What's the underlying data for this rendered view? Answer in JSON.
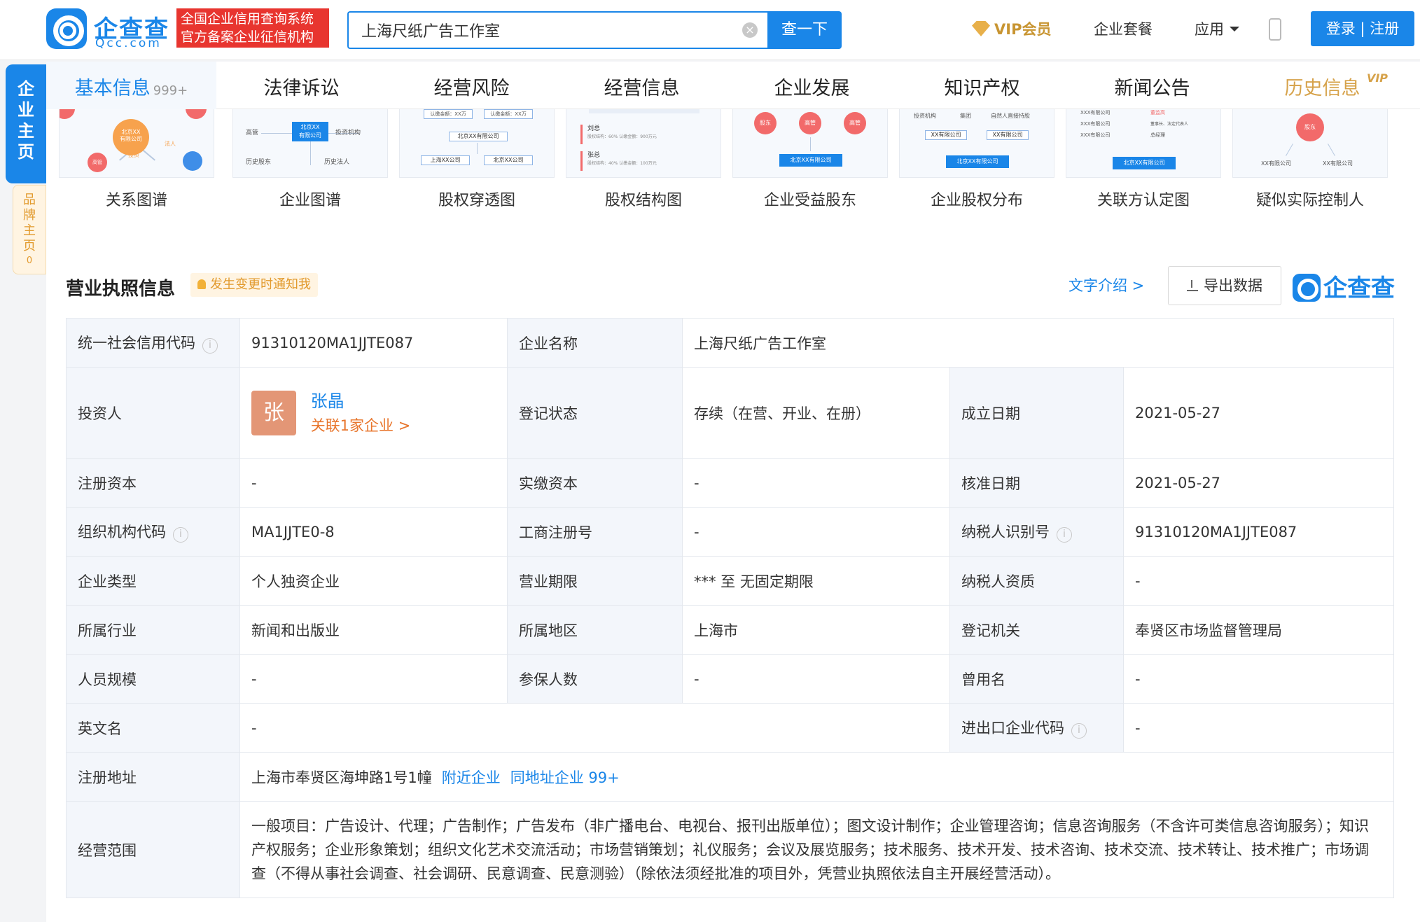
{
  "header": {
    "logo_cn": "企查查",
    "logo_en": "Qcc.com",
    "slogan_line1": "全国企业信用查询系统",
    "slogan_line2": "官方备案企业征信机构",
    "search_value": "上海尺纸广告工作室",
    "search_button": "查一下",
    "vip_label": "VIP会员",
    "nav_package": "企业套餐",
    "nav_apps": "应用",
    "login": "登录 | 注册"
  },
  "side": {
    "main": "企业主页",
    "brand": "品牌主页",
    "brand_count": "0"
  },
  "tabs": [
    {
      "label": "基本信息",
      "count": "999+"
    },
    {
      "label": "法律诉讼"
    },
    {
      "label": "经营风险"
    },
    {
      "label": "经营信息"
    },
    {
      "label": "企业发展"
    },
    {
      "label": "知识产权"
    },
    {
      "label": "新闻公告"
    },
    {
      "label": "历史信息",
      "tag": "VIP"
    }
  ],
  "graphs": [
    {
      "label": "关系图谱",
      "texts": [
        "北京XX",
        "有限公司",
        "高管",
        "投资",
        "法人"
      ]
    },
    {
      "label": "企业图谱",
      "texts": [
        "高管",
        "北京XX",
        "有限公司",
        "投资机构",
        "历史股东",
        "历史法人"
      ]
    },
    {
      "label": "股权穿透图",
      "texts": [
        "认缴金额：XX万",
        "认缴金额：XX万",
        "北京XX有限公司",
        "上海XX公司",
        "北京XX公司"
      ]
    },
    {
      "label": "股权结构图",
      "texts": [
        "刘总",
        "股权结构：60%  认缴金额：900万元",
        "张总",
        "股权结构：40%  认缴金额：100万元"
      ]
    },
    {
      "label": "企业受益股东",
      "texts": [
        "股东",
        "高管",
        "高管",
        "北京XX有限公司"
      ]
    },
    {
      "label": "企业股权分布",
      "texts": [
        "投资机构",
        "集团",
        "自然人直接持股",
        "XX有限公司",
        "XX有限公司",
        "北京XX有限公司"
      ]
    },
    {
      "label": "关联方认定图",
      "texts": [
        "XXX有限公司",
        "XXX有限公司",
        "XXX有限公司",
        "董监高",
        "董事长、法定代表人",
        "总经理",
        "北京XX有限公司"
      ]
    },
    {
      "label": "疑似实际控制人",
      "texts": [
        "股东",
        "XX有限公司",
        "XX有限公司"
      ]
    }
  ],
  "section": {
    "title": "营业执照信息",
    "notify": "发生变更时通知我",
    "text_intro": "文字介绍 >",
    "export": "导出数据",
    "brand": "企查查"
  },
  "info": {
    "credit_code_label": "统一社会信用代码",
    "credit_code": "91310120MA1JJTE087",
    "company_name_label": "企业名称",
    "company_name": "上海尺纸广告工作室",
    "investor_label": "投资人",
    "investor_avatar": "张",
    "investor_name": "张晶",
    "investor_related": "关联1家企业 >",
    "reg_status_label": "登记状态",
    "reg_status": "存续（在营、开业、在册）",
    "founded_label": "成立日期",
    "founded": "2021-05-27",
    "reg_capital_label": "注册资本",
    "reg_capital": "-",
    "paid_capital_label": "实缴资本",
    "paid_capital": "-",
    "approval_date_label": "核准日期",
    "approval_date": "2021-05-27",
    "org_code_label": "组织机构代码",
    "org_code": "MA1JJTE0-8",
    "biz_reg_no_label": "工商注册号",
    "biz_reg_no": "-",
    "taxpayer_id_label": "纳税人识别号",
    "taxpayer_id": "91310120MA1JJTE087",
    "company_type_label": "企业类型",
    "company_type": "个人独资企业",
    "biz_term_label": "营业期限",
    "biz_term": "*** 至 无固定期限",
    "taxpayer_qual_label": "纳税人资质",
    "taxpayer_qual": "-",
    "industry_label": "所属行业",
    "industry": "新闻和出版业",
    "region_label": "所属地区",
    "region": "上海市",
    "authority_label": "登记机关",
    "authority": "奉贤区市场监督管理局",
    "staff_size_label": "人员规模",
    "staff_size": "-",
    "insured_label": "参保人数",
    "insured": "-",
    "former_name_label": "曾用名",
    "former_name": "-",
    "english_name_label": "英文名",
    "english_name": "-",
    "import_export_label": "进出口企业代码",
    "import_export": "-",
    "address_label": "注册地址",
    "address": "上海市奉贤区海坤路1号1幢",
    "nearby": "附近企业",
    "same_address": "同地址企业 99+",
    "scope_label": "经营范围",
    "scope": "一般项目：广告设计、代理；广告制作；广告发布（非广播电台、电视台、报刊出版单位）；图文设计制作；企业管理咨询；信息咨询服务（不含许可类信息咨询服务）；知识产权服务；企业形象策划；组织文化艺术交流活动；市场营销策划；礼仪服务；会议及展览服务；技术服务、技术开发、技术咨询、技术交流、技术转让、技术推广；市场调查（不得从事社会调查、社会调研、民意调查、民意测验）（除依法须经批准的项目外，凭营业执照依法自主开展经营活动）。"
  },
  "colors": {
    "brand_blue": "#1a86e8",
    "slogan_red": "#e8352f",
    "vip_gold": "#c89532",
    "orange_link": "#e8762d"
  }
}
